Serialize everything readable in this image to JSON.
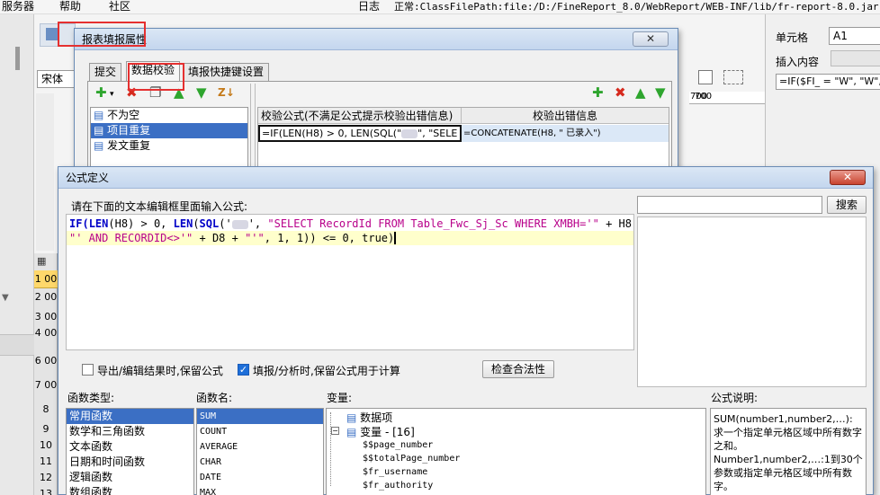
{
  "menubar": {
    "items": [
      "服务器",
      "帮助",
      "社区"
    ],
    "log_label": "日志",
    "status_text": "正常:ClassFilePath:file:/D:/FineReport_8.0/WebReport/WEB-INF/lib/fr-report-8.0.jar!/com/"
  },
  "workspace": {
    "font_select": "宋体",
    "ruler_mark": "700",
    "row_numbers": [
      "1",
      "2",
      "3",
      "4",
      "6",
      "7",
      "8",
      "9",
      "10",
      "11",
      "12",
      "13"
    ],
    "row_ruler": [
      "1 00",
      "2 00",
      "3 00",
      "4 00",
      "6 00",
      "7 00"
    ]
  },
  "property_panel": {
    "cell_label": "单元格",
    "cell_value": "A1",
    "insert_label": "插入内容",
    "formula_preview": "=IF($FI_ = \"W\", \"W\","
  },
  "report_dialog": {
    "title": "报表填报属性",
    "close": "✕",
    "tabs": [
      "提交",
      "数据校验",
      "填报快捷键设置"
    ],
    "ruler_mark": "700",
    "rules": [
      "不为空",
      "项目重复",
      "发文重复"
    ],
    "table": {
      "headers": [
        "校验公式(不满足公式提示校验出错信息)",
        "校验出错信息"
      ],
      "row": {
        "formula": "=IF(LEN(H8) > 0, LEN(SQL(\"",
        "formula_tail": "\", \"SELE",
        "message": "=CONCATENATE(H8, \" 已录入\")"
      }
    }
  },
  "formula_dialog": {
    "title": "公式定义",
    "close": "✕",
    "prompt": "请在下面的文本编辑框里面输入公式:",
    "code": {
      "l1_if": "IF(",
      "l1_len": "LEN",
      "l1_a": "(H8) > 0, ",
      "l1_len2": "LEN",
      "l1_b": "(",
      "l1_sql": "SQL",
      "l1_c": "('",
      "l1_d": "', ",
      "l1_str": "\"SELECT RecordId FROM Table_Fwc_Sj_Sc WHERE XMBH='\"",
      "l1_e": " + H8 +",
      "l2_str": "\"' AND RECORDID<>'\"",
      "l2_a": " + D8 + ",
      "l2_str2": "\"'\"",
      "l2_b": ", 1, 1)) <= 0, true)"
    },
    "search_placeholder": "",
    "search_button": "搜索",
    "opt_export": "导出/编辑结果时,保留公式",
    "opt_fill": "填报/分析时,保留公式用于计算",
    "opt_export_checked": false,
    "opt_fill_checked": true,
    "check_button": "检查合法性",
    "func_type_label": "函数类型:",
    "func_types": [
      "常用函数",
      "数学和三角函数",
      "文本函数",
      "日期和时间函数",
      "逻辑函数",
      "数组函数"
    ],
    "func_name_label": "函数名:",
    "func_names": [
      "SUM",
      "COUNT",
      "AVERAGE",
      "CHAR",
      "DATE",
      "MAX"
    ],
    "var_label": "变量:",
    "var_tree": {
      "data_item": "数据项",
      "var_group": "变量 - [16]",
      "vars": [
        "$$page_number",
        "$$totalPage_number",
        "$fr_username",
        "$fr_authority"
      ]
    },
    "desc_label": "公式说明:",
    "desc_text": "SUM(number1,number2,…): 求一个指定单元格区域中所有数字之和。\nNumber1,number2,…:1到30个参数或指定单元格区域中所有数字。"
  },
  "colors": {
    "selection": "#3b6fc4",
    "annotation": "#e53030",
    "keyword": "#0000c8",
    "string": "#b8008a",
    "current_line": "#ffffcc"
  }
}
